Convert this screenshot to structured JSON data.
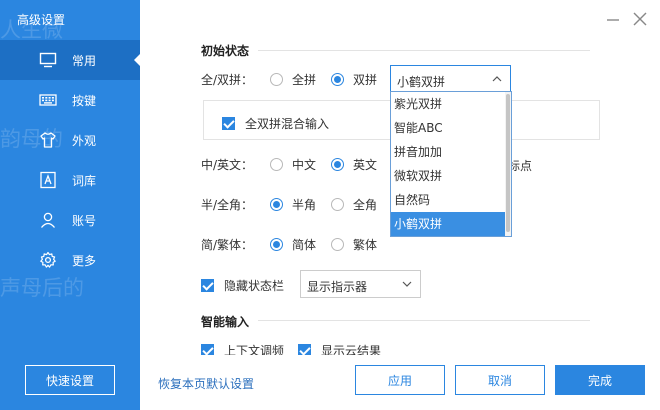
{
  "window": {
    "title": "高级设置",
    "watermark_lines": [
      "人生微",
      "韵母的",
      "声母后的"
    ]
  },
  "sidebar": {
    "items": [
      {
        "label": "常用",
        "icon": "monitor-icon",
        "active": true
      },
      {
        "label": "按键",
        "icon": "keyboard-icon",
        "active": false
      },
      {
        "label": "外观",
        "icon": "shirt-icon",
        "active": false
      },
      {
        "label": "词库",
        "icon": "dictionary-icon",
        "active": false
      },
      {
        "label": "账号",
        "icon": "user-icon",
        "active": false
      },
      {
        "label": "更多",
        "icon": "gear-icon",
        "active": false
      }
    ],
    "quick_button": "快速设置"
  },
  "section_initial": {
    "title": "初始状态",
    "full_double": {
      "label": "全/双拼：",
      "options": [
        "全拼",
        "双拼"
      ],
      "selected": "双拼",
      "combo_value": "小鹤双拼"
    },
    "mix_checkbox": {
      "label": "全双拼混合输入",
      "checked": true
    },
    "cn_en": {
      "label": "中/英文：",
      "options": [
        "中文",
        "英文"
      ],
      "selected": "英文",
      "partial_text": "标点"
    },
    "half_full": {
      "label": "半/全角：",
      "options": [
        "半角",
        "全角"
      ],
      "selected": "半角"
    },
    "simp_trad": {
      "label": "简/繁体：",
      "options": [
        "简体",
        "繁体"
      ],
      "selected": "简体"
    },
    "hide_status": {
      "label": "隐藏状态栏",
      "checked": true,
      "combo_value": "显示指示器"
    }
  },
  "section_smart": {
    "title": "智能输入",
    "partial_items": [
      "上下文调频",
      "显示云结果"
    ]
  },
  "dropdown": {
    "options": [
      "紫光双拼",
      "智能ABC",
      "拼音加加",
      "微软双拼",
      "自然码",
      "小鹤双拼"
    ],
    "selected": "小鹤双拼"
  },
  "footer": {
    "reset_link": "恢复本页默认设置",
    "apply": "应用",
    "cancel": "取消",
    "done": "完成"
  },
  "colors": {
    "accent": "#2b86e0",
    "sidebar_active": "#1d6fc4",
    "link": "#2b6fbd"
  }
}
